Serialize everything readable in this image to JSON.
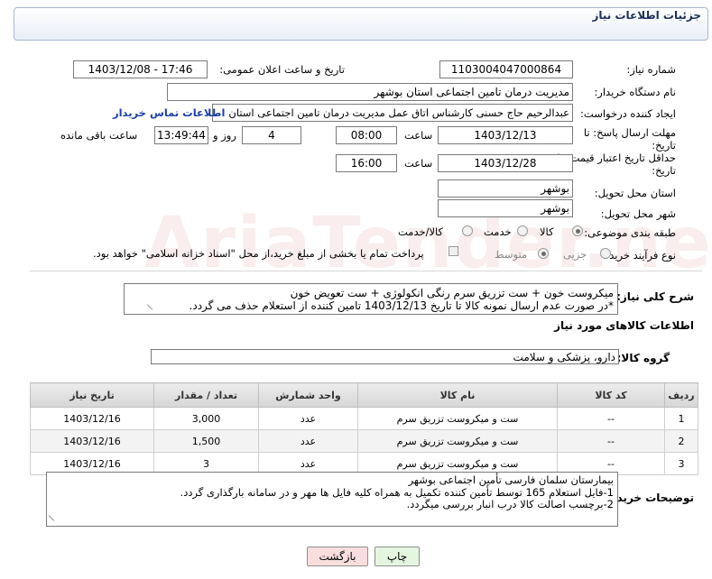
{
  "page": {
    "title": "جزئیات اطلاعات نیاز"
  },
  "fields": {
    "need_number": {
      "label": "شماره نیاز:",
      "value": "1103004047000864"
    },
    "announce_datetime": {
      "label": "تاریخ و ساعت اعلان عمومی:",
      "value": "1403/12/08 - 17:46"
    },
    "buyer_org": {
      "label": "نام دستگاه خریدار:",
      "value": "مدیریت درمان تامین اجتماعی استان بوشهر"
    },
    "requester": {
      "label": "ایجاد کننده درخواست:",
      "value": "عبدالرحیم حاج حسنی کارشناس اتاق عمل مدیریت درمان تامین اجتماعی استان",
      "link": "اطلاعات تماس خریدار"
    },
    "send_deadline": {
      "label_line1": "مهلت ارسال پاسخ: تا",
      "label_line2": "تاریخ:",
      "date": "1403/12/13",
      "time_label": "ساعت",
      "time": "08:00",
      "days": "4",
      "days_label": "روز و",
      "remaining": "13:49:44",
      "remaining_label": "ساعت باقی مانده"
    },
    "price_validity": {
      "label_line1": "حداقل تاریخ اعتبار قیمت: تا",
      "label_line2": "تاریخ:",
      "date": "1403/12/28",
      "time_label": "ساعت",
      "time": "16:00"
    },
    "delivery_province": {
      "label": "استان محل تحویل:",
      "value": "بوشهر"
    },
    "delivery_city": {
      "label": "شهر محل تحویل:",
      "value": "بوشهر"
    },
    "category": {
      "label": "طبقه بندی موضوعی:",
      "options": [
        "کالا",
        "خدمت",
        "کالا/خدمت"
      ],
      "selected": "کالا"
    },
    "purchase_process": {
      "label": "نوع فرآیند خرید :",
      "options": [
        "جزیی",
        "متوسط"
      ],
      "selected": "متوسط",
      "checkbox_text": "پرداخت تمام یا بخشی از مبلغ خرید،از محل \"اسناد خزانه اسلامی\" خواهد بود."
    }
  },
  "description": {
    "label": "شرح کلی نیاز:",
    "line1": "میکروست خون + ست تزریق سرم رنگی انکولوژی + ست تعویض خون",
    "line2": "*در صورت عدم ارسال نمونه کالا تا تاریخ 1403/12/13 تامین کننده از استعلام حذف می گردد."
  },
  "goods_section": {
    "title": "اطلاعات کالاهای مورد نیاز"
  },
  "goods_group": {
    "label": "گروه کالا:",
    "value": "دارو، پزشکی و سلامت"
  },
  "table": {
    "headers": [
      "ردیف",
      "کد کالا",
      "نام کالا",
      "واحد شمارش",
      "تعداد / مقدار",
      "تاریخ نیاز"
    ],
    "rows": [
      [
        "1",
        "--",
        "ست و میکروست تزریق سرم",
        "عدد",
        "3,000",
        "1403/12/16"
      ],
      [
        "2",
        "--",
        "ست و میکروست تزریق سرم",
        "عدد",
        "1,500",
        "1403/12/16"
      ],
      [
        "3",
        "--",
        "ست و میکروست تزریق سرم",
        "عدد",
        "3",
        "1403/12/16"
      ]
    ]
  },
  "buyer_notes": {
    "label": "توضیحات خریدار:",
    "line1": "بیمارستان سلمان فارسی تأمین اجتماعی بوشهر",
    "line2": "1-فایل استعلام 165 توسط تأمین کننده تکمیل به همراه کلیه فایل ها مهر و در سامانه بارگذاری گردد.",
    "line3": "2-برچسب اصالت کالا درب انبار بررسی میگردد."
  },
  "buttons": {
    "print": "چاپ",
    "back": "بازگشت"
  },
  "colors": {
    "panel_border": "#a9b8cf",
    "title": "#1b2f5b",
    "link": "#1a3fa8",
    "back_button": "#f9dede",
    "print_button": "#e4f6df"
  }
}
